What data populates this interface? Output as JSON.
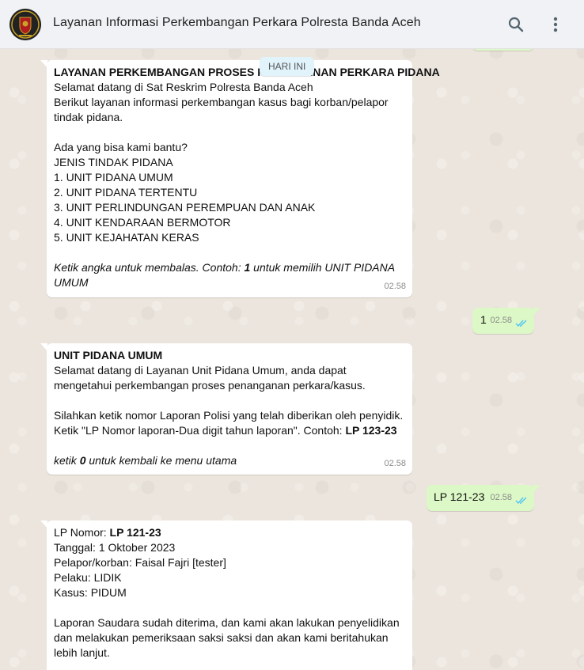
{
  "header": {
    "title": "Layanan Informasi Perkembangan Perkara Polresta Banda Aceh",
    "search_icon": "search-icon",
    "menu_icon": "more-vertical-icon"
  },
  "day_badge": "HARI INI",
  "messages": [
    {
      "type": "incoming",
      "heading": "LAYANAN PERKEMBANGAN PROSES PENANGANAN PERKARA PIDANA",
      "lines": [
        "Selamat datang di Sat Reskrim Polresta Banda Aceh",
        "Berikut layanan informasi perkembangan kasus bagi korban/pelapor",
        "tindak pidana.",
        "",
        "Ada yang bisa kami bantu?",
        "JENIS TINDAK PIDANA",
        "1. UNIT PIDANA UMUM",
        "2. UNIT PIDANA TERTENTU",
        "3. UNIT PERLINDUNGAN PEREMPUAN DAN ANAK",
        "4. UNIT KENDARAAN BERMOTOR",
        "5. UNIT KEJAHATAN KERAS",
        ""
      ],
      "hint_prefix": "Ketik angka untuk membalas. Contoh: ",
      "hint_bold": "1",
      "hint_suffix": " untuk memilih UNIT PIDANA",
      "hint_line2": "UMUM",
      "time": "02.58"
    },
    {
      "type": "outgoing",
      "text": "1",
      "time": "02.58"
    },
    {
      "type": "incoming",
      "heading": "UNIT PIDANA UMUM",
      "lines": [
        "Selamat datang di Layanan Unit Pidana Umum, anda dapat",
        "mengetahui perkembangan proses penanganan perkara/kasus.",
        "",
        "Silahkan ketik nomor Laporan Polisi yang telah diberikan oleh penyidik."
      ],
      "example_prefix": "Ketik \"LP Nomor laporan-Dua digit tahun laporan\". Contoh: ",
      "example_bold": "LP 123-23",
      "footer_prefix": "ketik ",
      "footer_bold": "0",
      "footer_suffix": " untuk kembali ke menu utama",
      "time": "02.58"
    },
    {
      "type": "outgoing",
      "text": "LP 121-23",
      "time": "02.58"
    },
    {
      "type": "incoming",
      "lp_label": "LP Nomor: ",
      "lp_value": "LP 121-23",
      "lines": [
        "Tanggal: 1 Oktober 2023",
        "Pelapor/korban: Faisal Fajri [tester]",
        "Pelaku: LIDIK",
        "Kasus: PIDUM",
        "",
        "Laporan Saudara sudah diterima, dan kami akan lakukan penyelidikan",
        "dan melakukan pemeriksaan saksi saksi dan akan kami beritahukan",
        "lebih lanjut."
      ]
    }
  ],
  "colors": {
    "incoming_bg": "#ffffff",
    "outgoing_bg": "#dcf8c6",
    "read_tick": "#4fc3f7",
    "header_bg": "#f0f2f5"
  }
}
